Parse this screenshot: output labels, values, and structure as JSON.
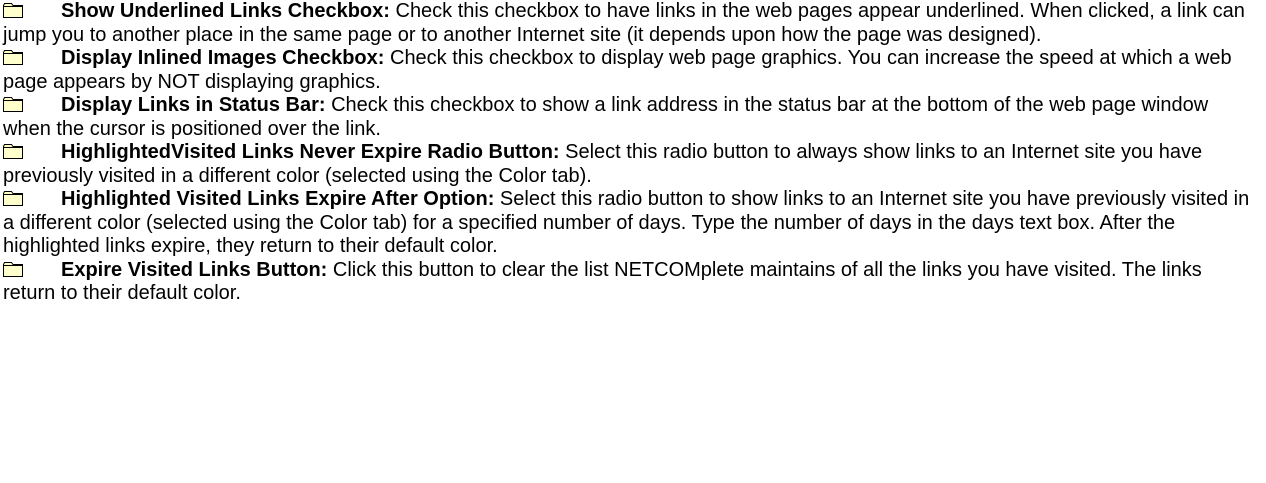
{
  "colors": {
    "folder_fill": "#ffffcc",
    "folder_stroke": "#000000",
    "text": "#000000",
    "background": "#ffffff"
  },
  "entries": [
    {
      "icon": "folder-icon",
      "term": "Show Underlined Links Checkbox:",
      "text": " Check this checkbox to have links in the web pages appear underlined. When clicked, a link can jump you to another place in the same page or to another Internet site (it depends upon how the page was designed)."
    },
    {
      "icon": "folder-icon",
      "term": "Display Inlined Images Checkbox:",
      "text": " Check this checkbox to display web page graphics. You can increase the speed at which a web page appears by NOT displaying graphics."
    },
    {
      "icon": "folder-icon",
      "term": "Display Links in Status Bar:",
      "text": " Check this checkbox to show a link address in the status bar at the bottom of the web page window when the cursor is positioned over the link."
    },
    {
      "icon": "folder-icon",
      "term": "HighlightedVisited Links Never Expire Radio Button:",
      "text": " Select this radio button to always show links to an Internet site you have previously visited in a different color (selected using the Color tab)."
    },
    {
      "icon": "folder-icon",
      "term": "Highlighted Visited Links Expire After Option:",
      "text": " Select this radio button to show links to an Internet site you have previously visited in a different color (selected using the Color tab) for a specified number of days. Type the number of days in the days text box. After the highlighted links expire, they return to their default color."
    },
    {
      "icon": "folder-icon",
      "term": "Expire Visited Links Button:",
      "text": " Click this button to clear the list NETCOMplete maintains of all the links you have visited. The links return to their default color."
    }
  ]
}
